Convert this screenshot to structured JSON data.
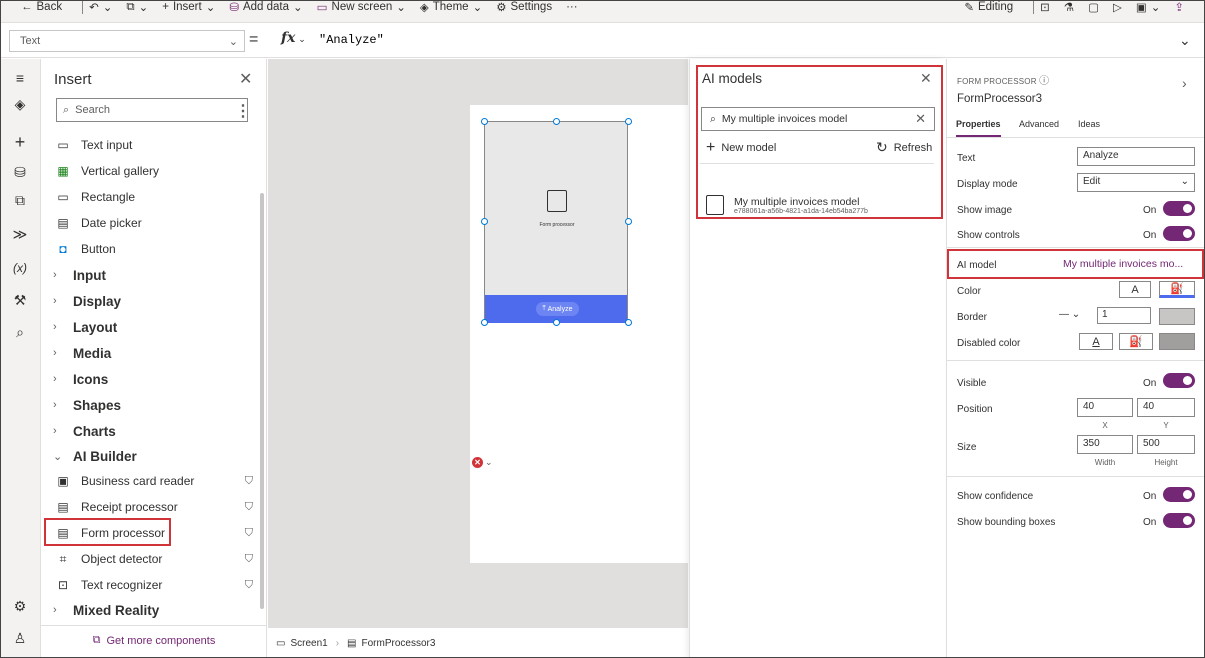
{
  "toolbar": {
    "back": "Back",
    "insert": "Insert",
    "add_data": "Add data",
    "new_screen": "New screen",
    "theme": "Theme",
    "settings": "Settings",
    "more": "···",
    "editing": "Editing"
  },
  "formula_bar": {
    "property": "Text",
    "equals": "=",
    "fx": "fx",
    "formula": "\"Analyze\""
  },
  "insert_pane": {
    "title": "Insert",
    "search_placeholder": "Search",
    "items": [
      {
        "label": "Text input",
        "icon": "text-input-icon"
      },
      {
        "label": "Vertical gallery",
        "icon": "gallery-icon"
      },
      {
        "label": "Rectangle",
        "icon": "rectangle-icon"
      },
      {
        "label": "Date picker",
        "icon": "calendar-icon"
      },
      {
        "label": "Button",
        "icon": "button-icon"
      }
    ],
    "categories": [
      "Input",
      "Display",
      "Layout",
      "Media",
      "Icons",
      "Shapes",
      "Charts"
    ],
    "ai_builder": {
      "label": "AI Builder",
      "items": [
        {
          "label": "Business card reader",
          "icon": "business-card-icon"
        },
        {
          "label": "Receipt processor",
          "icon": "receipt-icon"
        },
        {
          "label": "Form processor",
          "icon": "form-icon"
        },
        {
          "label": "Object detector",
          "icon": "object-detector-icon"
        },
        {
          "label": "Text recognizer",
          "icon": "text-recognizer-icon"
        }
      ]
    },
    "mixed_reality": "Mixed Reality",
    "get_more": "Get more components"
  },
  "canvas": {
    "control_label": "Form processor",
    "analyze_button": "Analyze"
  },
  "bottom_bar": {
    "screen": "Screen1",
    "control": "FormProcessor3"
  },
  "ai_models": {
    "title": "AI models",
    "search_value": "My multiple invoices model",
    "new_model": "New model",
    "refresh": "Refresh",
    "model": {
      "name": "My multiple invoices model",
      "id": "e788061a-a56b-4821-a1da-14eb54ba277b"
    }
  },
  "properties": {
    "type": "FORM PROCESSOR",
    "name": "FormProcessor3",
    "tabs": [
      "Properties",
      "Advanced",
      "Ideas"
    ],
    "text_label": "Text",
    "text_value": "Analyze",
    "display_mode_label": "Display mode",
    "display_mode_value": "Edit",
    "show_image_label": "Show image",
    "show_controls_label": "Show controls",
    "on": "On",
    "ai_model_label": "AI model",
    "ai_model_value": "My multiple invoices mo...",
    "color_label": "Color",
    "border_label": "Border",
    "border_value": "1",
    "disabled_color_label": "Disabled color",
    "visible_label": "Visible",
    "position_label": "Position",
    "position_x": "40",
    "position_y": "40",
    "x_label": "X",
    "y_label": "Y",
    "size_label": "Size",
    "size_width": "350",
    "size_height": "500",
    "width_label": "Width",
    "height_label": "Height",
    "show_confidence_label": "Show confidence",
    "show_bounding_label": "Show bounding boxes",
    "swatch_letter": "A"
  },
  "colors": {
    "accent": "#742774",
    "highlight_red": "#d13438",
    "button_blue": "#4f6bed"
  }
}
